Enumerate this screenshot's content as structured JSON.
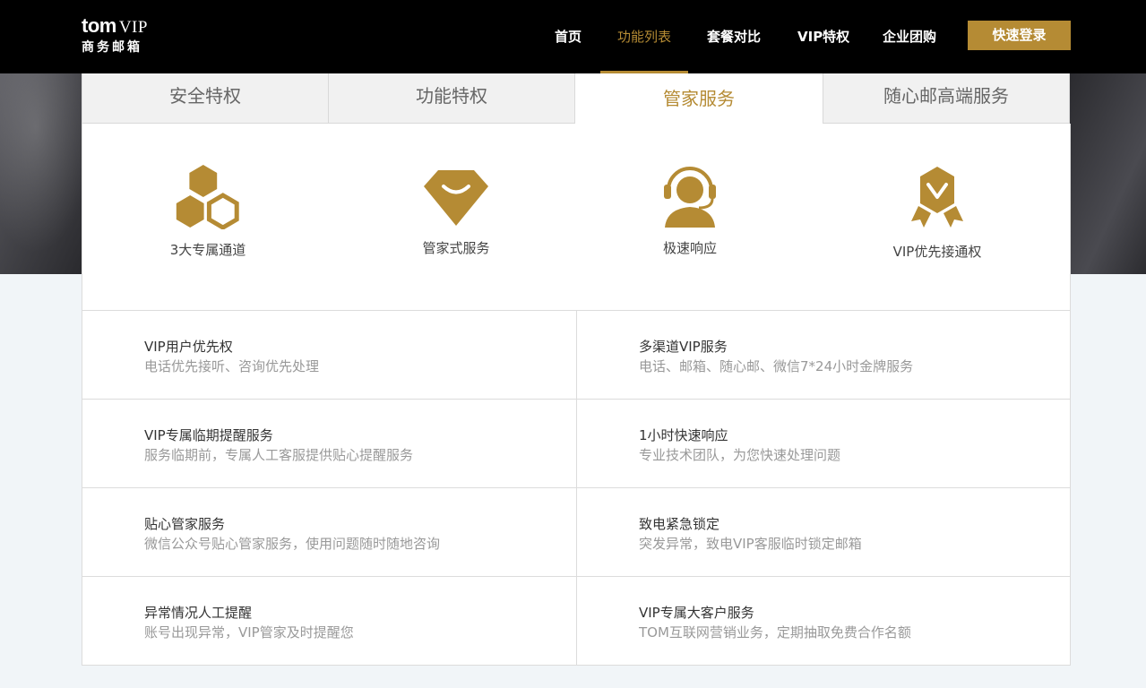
{
  "header": {
    "logo": {
      "brand": "tom",
      "vip": "VIP",
      "subtitle": "商务邮箱"
    },
    "nav": [
      {
        "label": "首页",
        "active": false
      },
      {
        "label": "功能列表",
        "active": true
      },
      {
        "label": "套餐对比",
        "active": false
      },
      {
        "label": "VIP特权",
        "active": false
      },
      {
        "label": "企业团购",
        "active": false
      }
    ],
    "login_label": "快速登录"
  },
  "tabs": [
    {
      "label": "安全特权",
      "active": false
    },
    {
      "label": "功能特权",
      "active": false
    },
    {
      "label": "管家服务",
      "active": true
    },
    {
      "label": "随心邮高端服务",
      "active": false
    }
  ],
  "features": [
    {
      "icon": "hexagon-cluster-icon",
      "label": "3大专属通道"
    },
    {
      "icon": "smile-diamond-icon",
      "label": "管家式服务"
    },
    {
      "icon": "headset-agent-icon",
      "label": "极速响应"
    },
    {
      "icon": "badge-check-icon",
      "label": "VIP优先接通权"
    }
  ],
  "services": [
    [
      {
        "title": "VIP用户优先权",
        "desc": "电话优先接听、咨询优先处理"
      },
      {
        "title": "多渠道VIP服务",
        "desc": "电话、邮箱、随心邮、微信7*24小时金牌服务"
      }
    ],
    [
      {
        "title": "VIP专属临期提醒服务",
        "desc": "服务临期前，专属人工客服提供贴心提醒服务"
      },
      {
        "title": "1小时快速响应",
        "desc": "专业技术团队，为您快速处理问题"
      }
    ],
    [
      {
        "title": "贴心管家服务",
        "desc": "微信公众号贴心管家服务，使用问题随时随地咨询"
      },
      {
        "title": "致电紧急锁定",
        "desc": "突发异常，致电VIP客服临时锁定邮箱"
      }
    ],
    [
      {
        "title": "异常情况人工提醒",
        "desc": "账号出现异常，VIP管家及时提醒您"
      },
      {
        "title": "VIP专属大客户服务",
        "desc": "TOM互联网营销业务，定期抽取免费合作名额"
      }
    ]
  ],
  "colors": {
    "accent": "#b58b34",
    "header_bg": "#000000",
    "page_bg": "#f1f5f8",
    "tab_inactive_bg": "#f1f1f1"
  }
}
